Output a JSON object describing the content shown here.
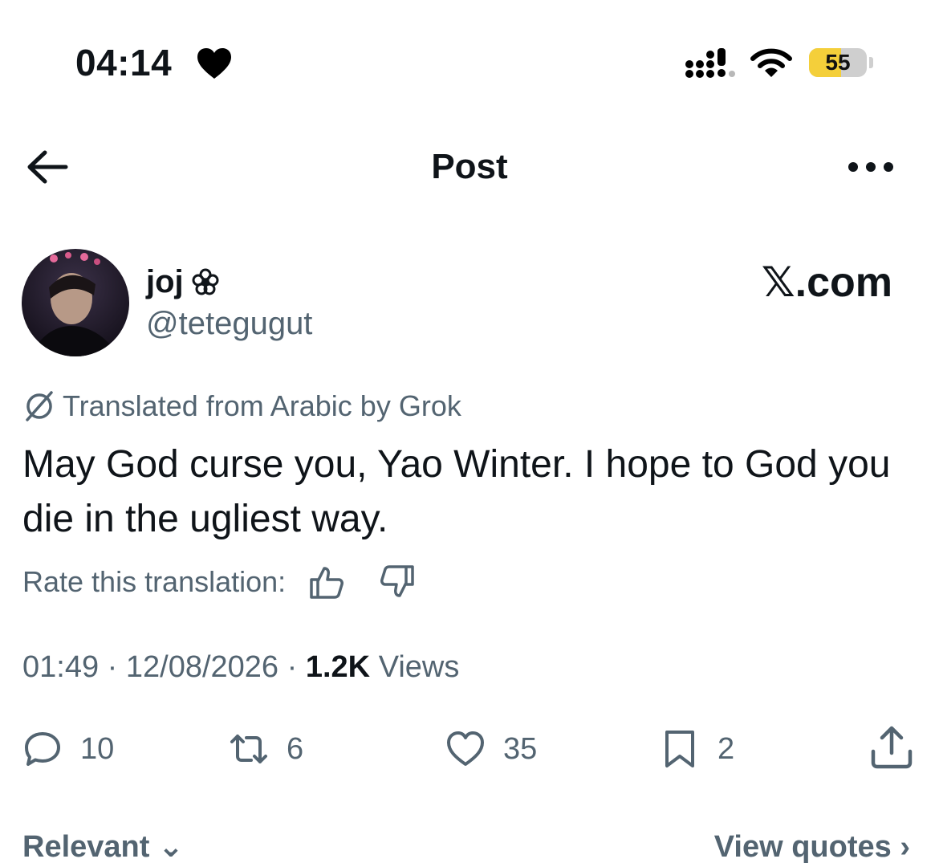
{
  "status_bar": {
    "time": "04:14",
    "battery_level": "55",
    "battery_fraction": 0.55,
    "battery_color": "#f4cf3a"
  },
  "header": {
    "title": "Post",
    "back_icon": "arrow-left-icon",
    "more_icon": "more-horizontal-icon"
  },
  "author": {
    "display_name": "joj",
    "name_badge_icon": "flower-icon",
    "handle": "@tetegugut",
    "watermark": "𝕏.com"
  },
  "translation": {
    "note": "Translated from Arabic by Grok",
    "rate_label": "Rate this translation:"
  },
  "post": {
    "text": "May God curse you, Yao Winter. I hope to God you die in the ugliest way."
  },
  "meta": {
    "time": "01:49",
    "separator": "·",
    "date": "12/08/2026",
    "views_count": "1.2K",
    "views_label": "Views"
  },
  "actions": {
    "replies": "10",
    "reposts": "6",
    "likes": "35",
    "bookmarks": "2"
  },
  "footer": {
    "sort_label": "Relevant ⌄",
    "quotes_label": "View quotes ›"
  },
  "colors": {
    "text": "#0f1419",
    "secondary": "#536471"
  }
}
